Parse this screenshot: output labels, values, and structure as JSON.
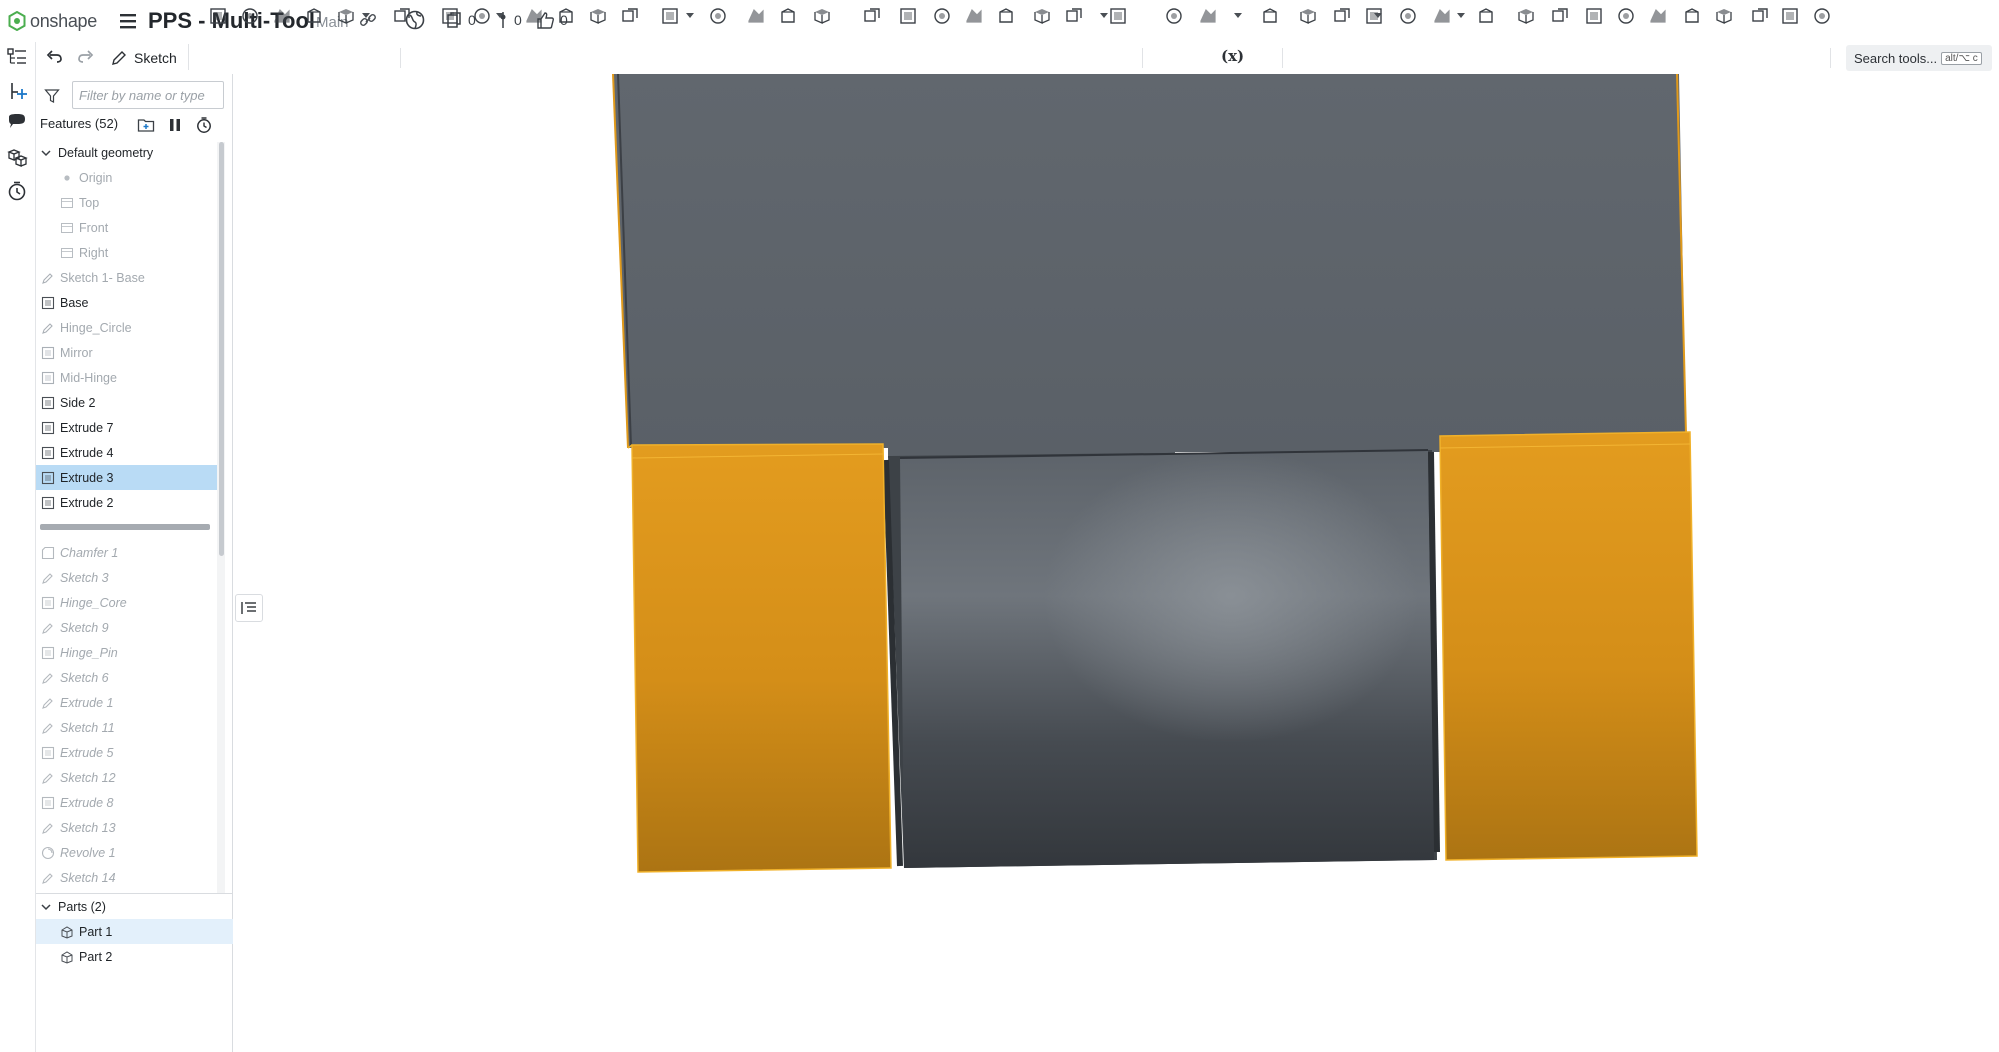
{
  "app": {
    "logo_text": "onshape",
    "document_title": "PPS - Multi-Tool",
    "branch": "Main",
    "counts": {
      "versions": "0",
      "branches": "0",
      "likes": "0"
    }
  },
  "toolbar": {
    "sketch_label": "Sketch",
    "variable_label": "(x)",
    "search_label": "Search tools...",
    "search_shortcut": "alt/⌥ c"
  },
  "feature_panel": {
    "filter_placeholder": "Filter by name or type",
    "features_header": "Features (52)",
    "groups": {
      "default_geometry": "Default geometry",
      "parts_header": "Parts (2)"
    },
    "default_geometry_items": [
      "Origin",
      "Top",
      "Front",
      "Right"
    ],
    "features": [
      {
        "label": "Sketch 1- Base",
        "icon": "sketch-icon",
        "state": "dim"
      },
      {
        "label": "Base",
        "icon": "extrude-icon",
        "state": "normal"
      },
      {
        "label": "Hinge_Circle",
        "icon": "sketch-icon",
        "state": "dim"
      },
      {
        "label": "Mirror",
        "icon": "extrude-icon",
        "state": "dim"
      },
      {
        "label": "Mid-Hinge",
        "icon": "extrude-icon",
        "state": "dim"
      },
      {
        "label": "Side 2",
        "icon": "extrude-icon",
        "state": "normal"
      },
      {
        "label": "Extrude 7",
        "icon": "extrude-icon",
        "state": "normal"
      },
      {
        "label": "Extrude 4",
        "icon": "extrude-icon",
        "state": "normal"
      },
      {
        "label": "Extrude 3",
        "icon": "extrude-icon",
        "state": "selected"
      },
      {
        "label": "Extrude 2",
        "icon": "extrude-icon",
        "state": "normal"
      }
    ],
    "rolled_back": [
      {
        "label": "Chamfer 1",
        "icon": "chamfer-icon"
      },
      {
        "label": "Sketch 3",
        "icon": "sketch-icon"
      },
      {
        "label": "Hinge_Core",
        "icon": "extrude-icon"
      },
      {
        "label": "Sketch 9",
        "icon": "sketch-icon"
      },
      {
        "label": "Hinge_Pin",
        "icon": "extrude-icon"
      },
      {
        "label": "Sketch 6",
        "icon": "sketch-icon"
      },
      {
        "label": "Extrude 1",
        "icon": "sketch-icon"
      },
      {
        "label": "Sketch 11",
        "icon": "sketch-icon"
      },
      {
        "label": "Extrude 5",
        "icon": "extrude-icon"
      },
      {
        "label": "Sketch 12",
        "icon": "sketch-icon"
      },
      {
        "label": "Extrude 8",
        "icon": "extrude-icon"
      },
      {
        "label": "Sketch 13",
        "icon": "sketch-icon"
      },
      {
        "label": "Revolve 1",
        "icon": "revolve-icon"
      },
      {
        "label": "Sketch 14",
        "icon": "sketch-icon"
      }
    ],
    "parts": [
      {
        "label": "Part 1",
        "icon": "part-icon",
        "state": "sel-light"
      },
      {
        "label": "Part 2",
        "icon": "part-icon",
        "state": "normal"
      }
    ]
  },
  "colors": {
    "model_gray": "#5f656c",
    "model_dark": "#3a3f45",
    "highlight_orange": "#e0991f",
    "selection_blue": "#b9dbf5",
    "brand_green": "#4bae4f"
  }
}
